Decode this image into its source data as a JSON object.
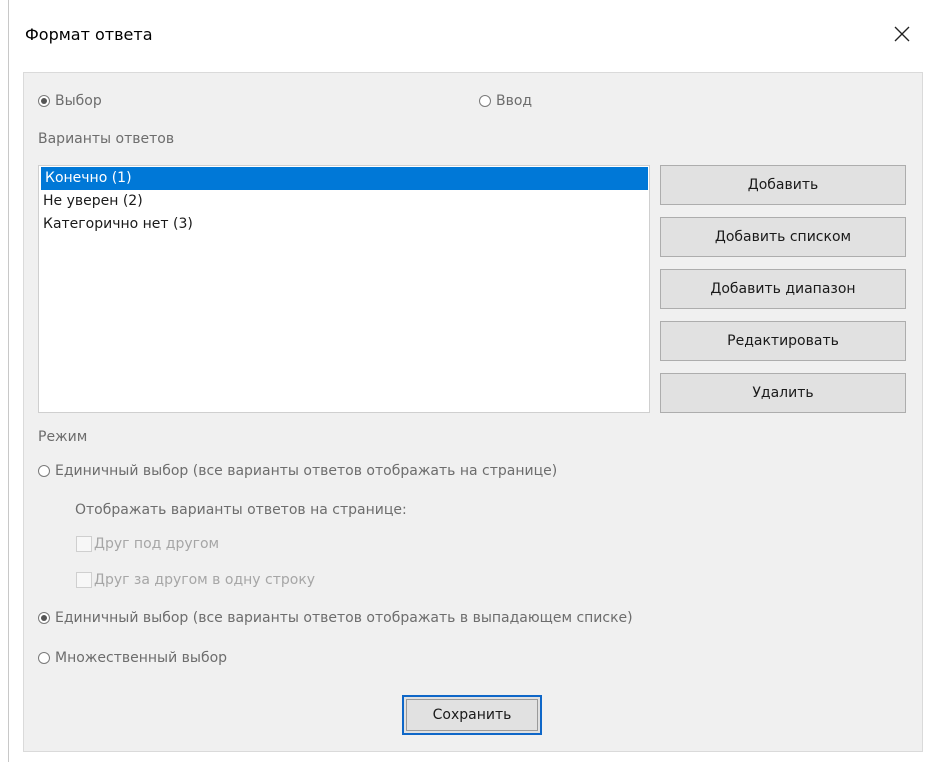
{
  "window": {
    "title": "Формат ответа"
  },
  "input_type": {
    "choice_label": "Выбор",
    "choice_selected": true,
    "input_label": "Ввод",
    "input_selected": false
  },
  "options": {
    "label": "Варианты ответов",
    "items": [
      {
        "text": "Конечно (1)",
        "selected": true
      },
      {
        "text": "Не уверен (2)",
        "selected": false
      },
      {
        "text": "Категорично нет (3)",
        "selected": false
      }
    ]
  },
  "buttons": {
    "add": "Добавить",
    "add_list": "Добавить списком",
    "add_range": "Добавить диапазон",
    "edit": "Редактировать",
    "delete": "Удалить",
    "save": "Сохранить"
  },
  "mode": {
    "label": "Режим",
    "single_on_page": "Единичный выбор (все варианты ответов отображать на странице)",
    "display_label": "Отображать варианты ответов на странице:",
    "one_below_other": "Друг под другом",
    "one_after_other": "Друг за другом в одну строку",
    "single_dropdown": "Единичный выбор (все варианты ответов отображать в выпадающем списке)",
    "multiple": "Множественный выбор",
    "selected": "single_dropdown"
  },
  "icons": {
    "close": "close-icon",
    "radio": "radio-icon",
    "checkbox": "checkbox-icon"
  },
  "colors": {
    "selection": "#0078d7",
    "panel": "#f0f0f0",
    "focus_border": "#0f67c8"
  }
}
